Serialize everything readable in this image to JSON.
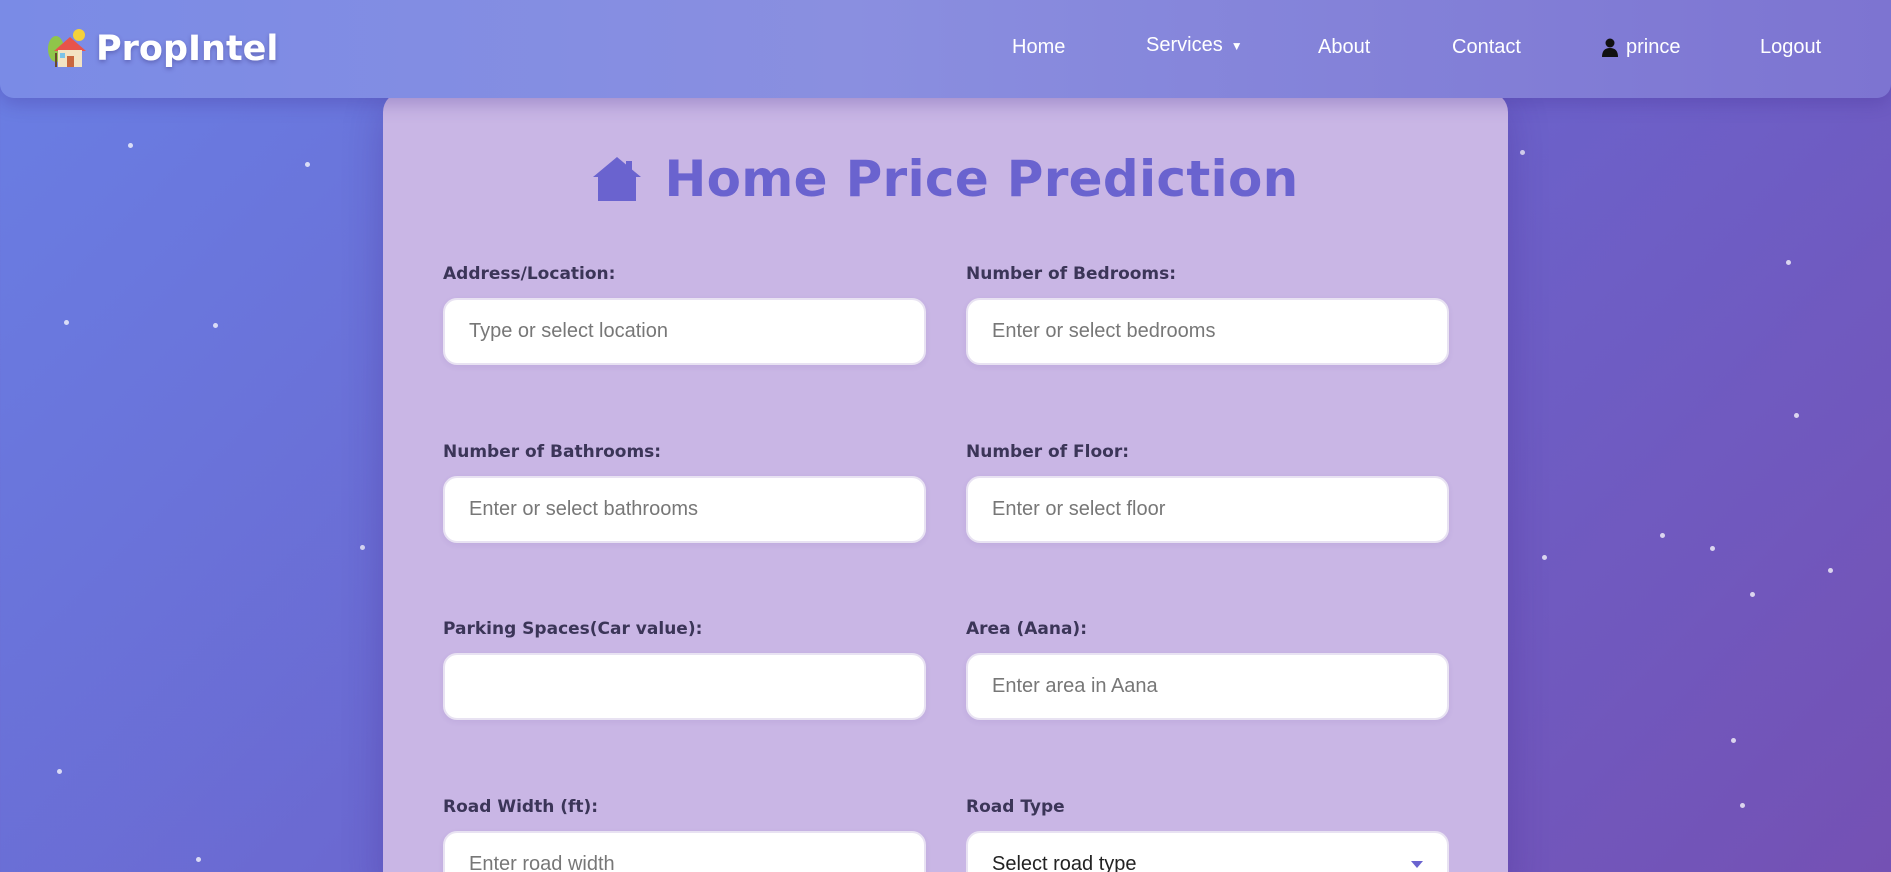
{
  "brand": {
    "name": "PropIntel"
  },
  "nav": {
    "home": "Home",
    "services": "Services",
    "services_caret": "▼",
    "about": "About",
    "contact": "Contact",
    "user": "prince",
    "logout": "Logout"
  },
  "page": {
    "title": "Home Price Prediction"
  },
  "form": {
    "address": {
      "label": "Address/Location:",
      "placeholder": "Type or select location"
    },
    "bedrooms": {
      "label": "Number of Bedrooms:",
      "placeholder": "Enter or select bedrooms"
    },
    "bathrooms": {
      "label": "Number of Bathrooms:",
      "placeholder": "Enter or select bathrooms"
    },
    "floor": {
      "label": "Number of Floor:",
      "placeholder": "Enter or select floor"
    },
    "parking": {
      "label": "Parking Spaces(Car value):",
      "placeholder": ""
    },
    "area": {
      "label": "Area (Aana):",
      "placeholder": "Enter area in Aana"
    },
    "road_width": {
      "label": "Road Width (ft):",
      "placeholder": "Enter road width"
    },
    "road_type": {
      "label": "Road Type",
      "selected": "Select road type"
    }
  },
  "colors": {
    "accent": "#6a63cf",
    "card": "#c9b6e5"
  },
  "icons": {
    "logo": "house-logo-icon",
    "title": "house-icon",
    "user": "user-icon",
    "caret": "chevron-down-icon"
  }
}
